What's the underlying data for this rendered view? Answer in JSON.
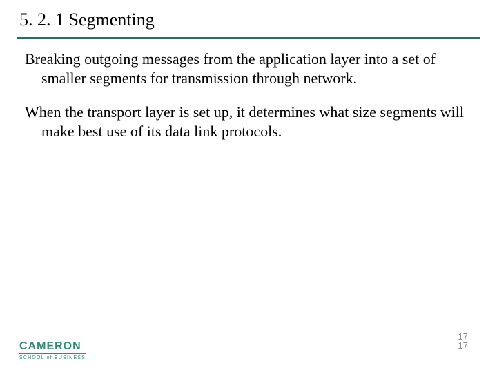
{
  "title": "5. 2. 1  Segmenting",
  "paragraphs": [
    "Breaking outgoing messages from the application layer into a set of smaller segments for transmission through network.",
    "When the transport layer is set up, it determines what size segments will make best use of its data link protocols."
  ],
  "logo": {
    "top": "CAMERON",
    "bottom": "SCHOOL of BUSINESS"
  },
  "page": {
    "a": "17",
    "b": "17"
  }
}
